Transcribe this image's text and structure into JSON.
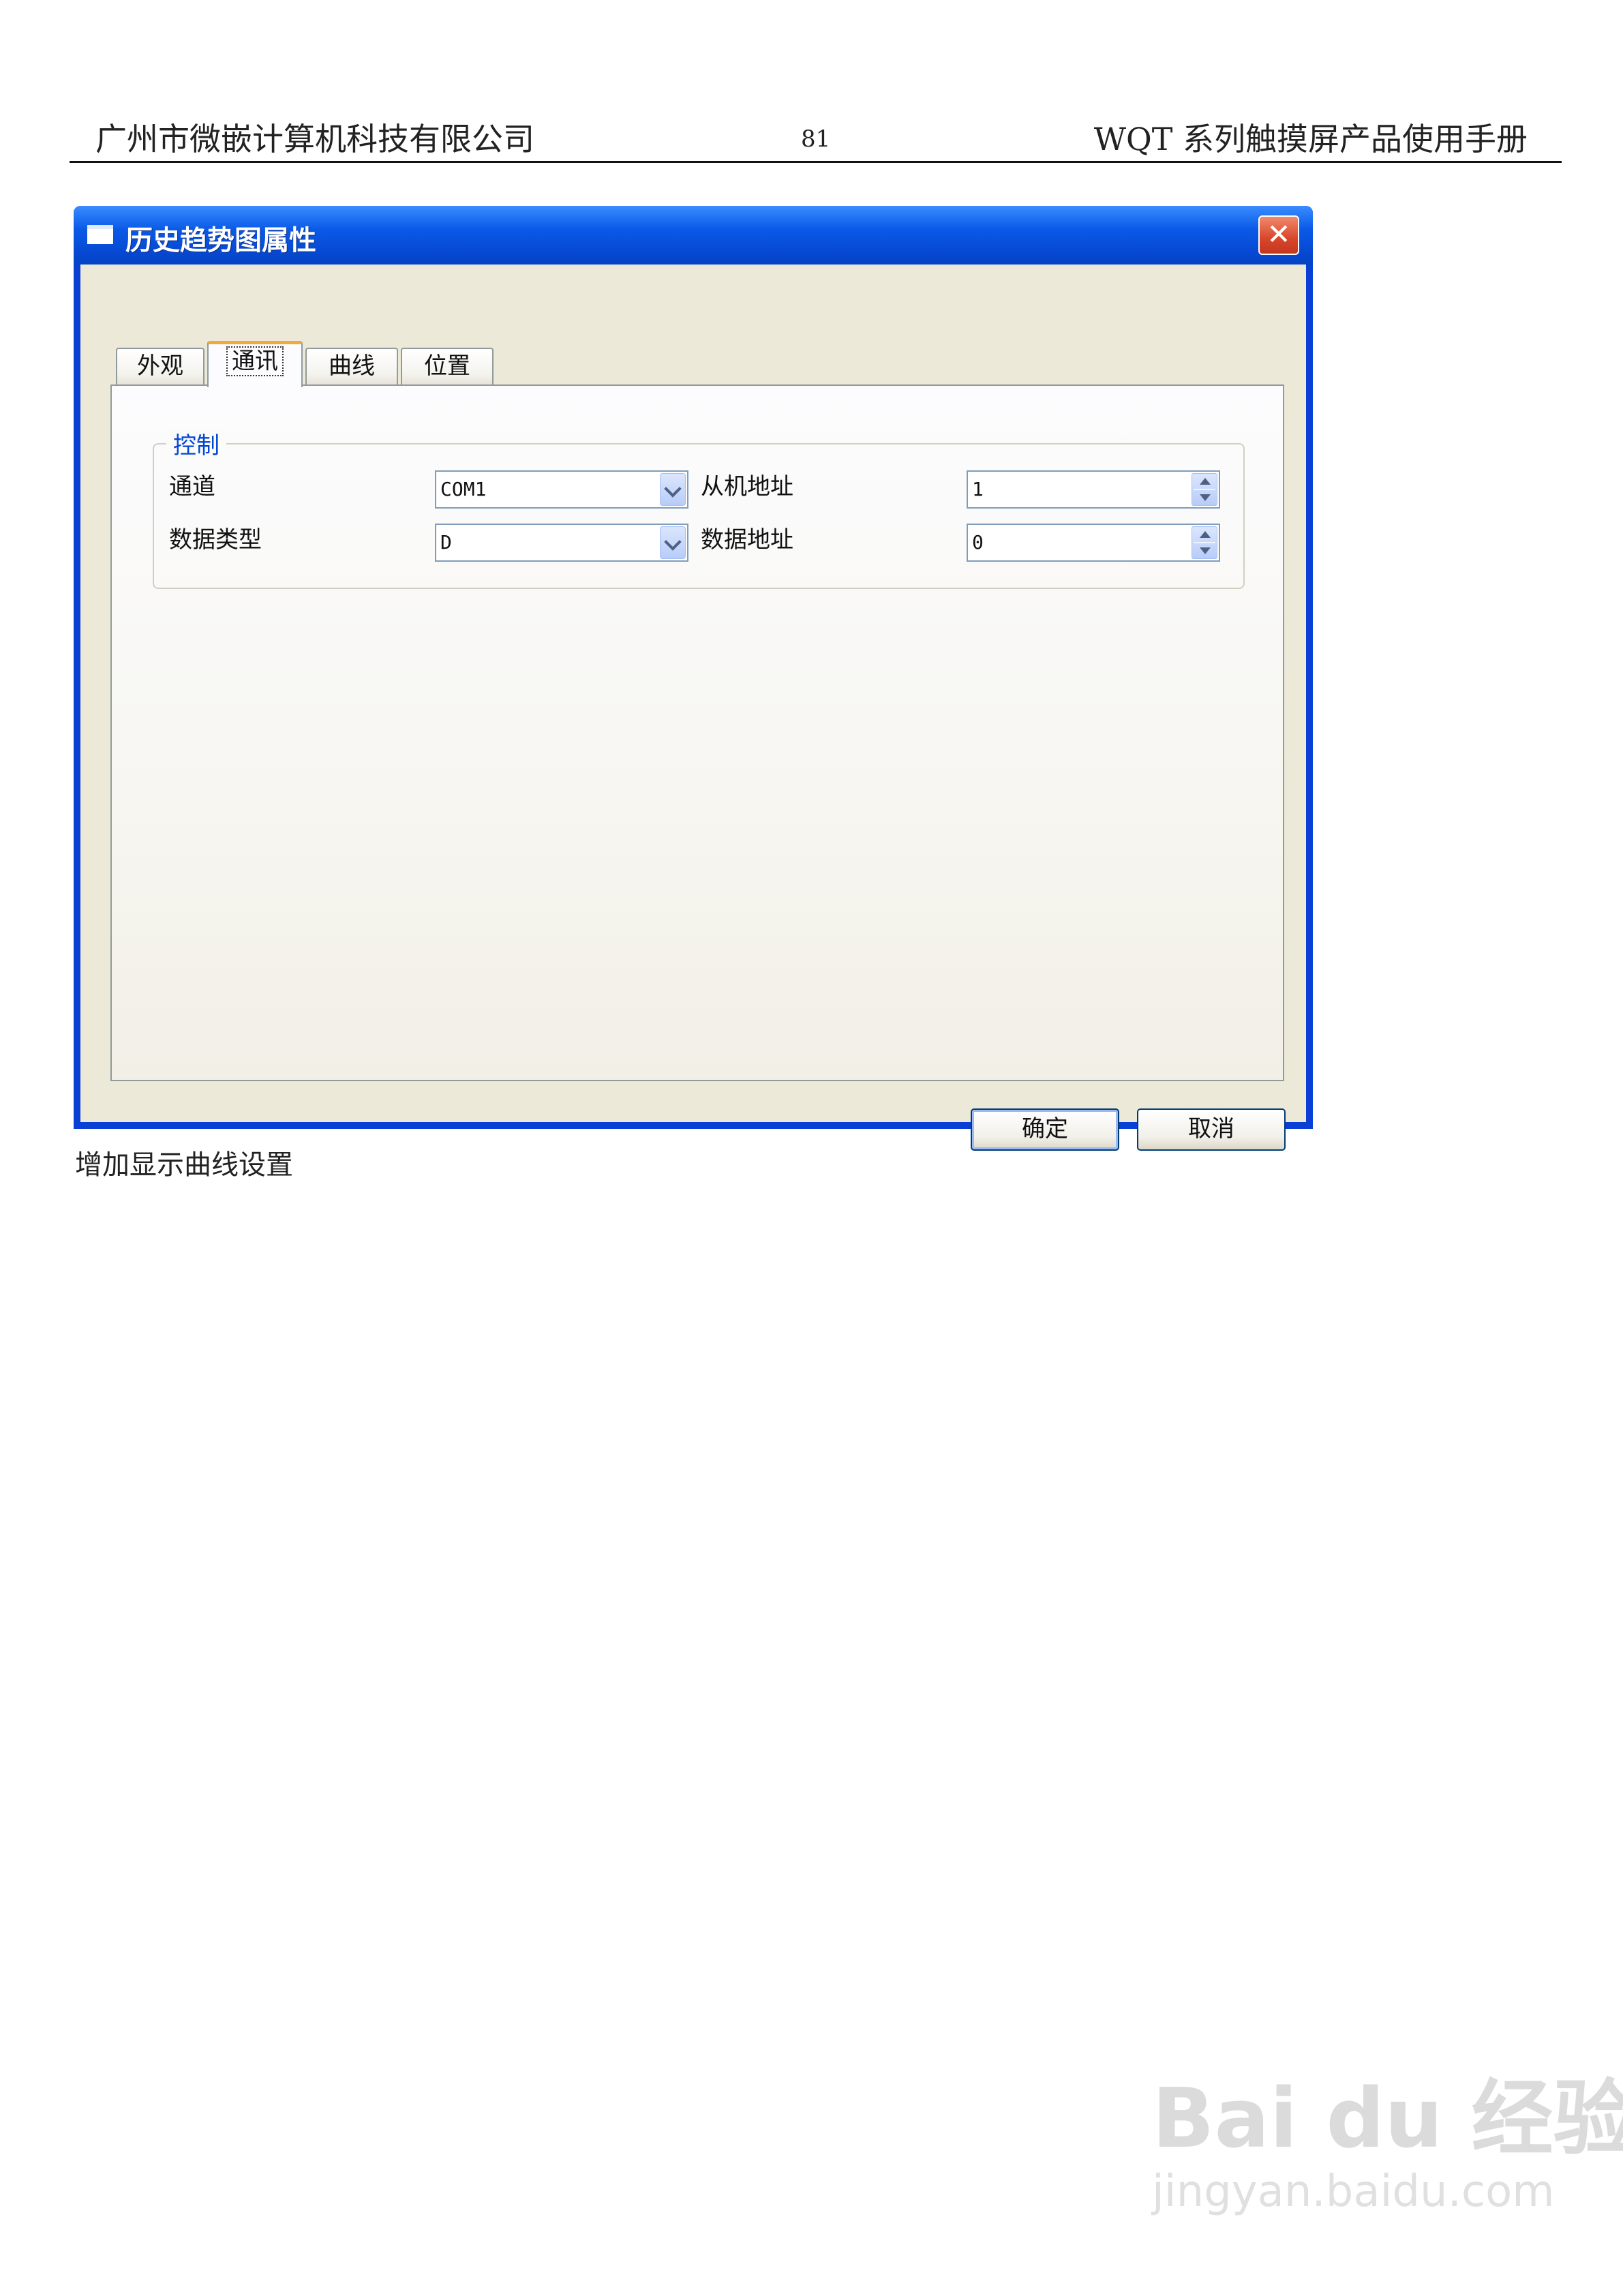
{
  "header": {
    "company": "广州市微嵌计算机科技有限公司",
    "page_number": "81",
    "manual_title": "WQT 系列触摸屏产品使用手册"
  },
  "dialog": {
    "title": "历史趋势图属性",
    "close_symbol": "✕",
    "tabs": [
      "外观",
      "通讯",
      "曲线",
      "位置"
    ],
    "active_tab": "通讯",
    "group_title": "控制",
    "fields": {
      "channel_label": "通道",
      "channel_value": "COM1",
      "slave_label": "从机地址",
      "slave_value": "1",
      "datatype_label": "数据类型",
      "datatype_value": "D",
      "dataaddr_label": "数据地址",
      "dataaddr_value": "0"
    },
    "ok_label": "确定",
    "cancel_label": "取消"
  },
  "caption": "增加显示曲线设置",
  "watermark": {
    "logo": "Bai du 经验",
    "url": "jingyan.baidu.com"
  }
}
